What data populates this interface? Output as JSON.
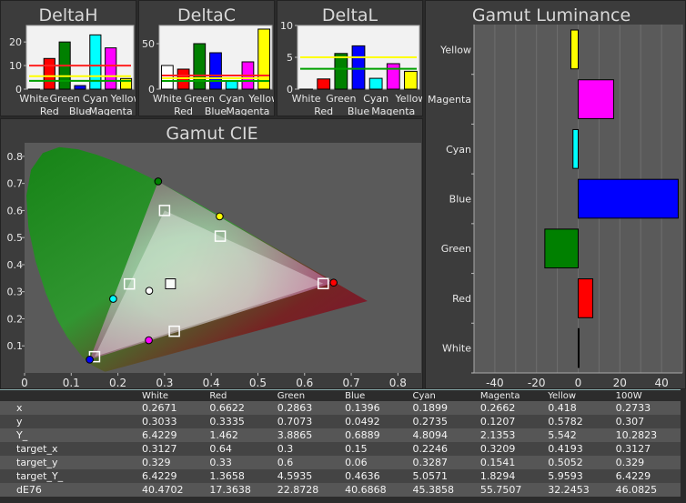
{
  "colors": {
    "White": "#ffffff",
    "Red": "#ff0000",
    "Green": "#008000",
    "Blue": "#0000ff",
    "Cyan": "#00ffff",
    "Magenta": "#ff00ff",
    "Yellow": "#ffff00"
  },
  "chart_data": [
    {
      "id": "deltaH",
      "type": "bar",
      "title": "DeltaH",
      "categories": [
        "White",
        "Red",
        "Green",
        "Blue",
        "Cyan",
        "Magenta",
        "Yellow"
      ],
      "tick_rows": [
        [
          "White",
          "Green",
          "Cyan",
          "Yellow"
        ],
        [
          "Red",
          "Blue",
          "Magenta"
        ]
      ],
      "values": [
        0,
        13,
        20,
        1.5,
        23,
        17.5,
        4.5
      ],
      "ylim": [
        0,
        27
      ],
      "yticks": [
        0,
        10,
        20
      ],
      "threshold_lines": [
        {
          "value": 10,
          "color": "#ff2020"
        },
        {
          "value": 5.5,
          "color": "#ffff00"
        },
        {
          "value": 3.5,
          "color": "#00a000"
        }
      ]
    },
    {
      "id": "deltaC",
      "type": "bar",
      "title": "DeltaC",
      "categories": [
        "White",
        "Red",
        "Green",
        "Blue",
        "Cyan",
        "Magenta",
        "Yellow"
      ],
      "tick_rows": [
        [
          "White",
          "Green",
          "Cyan",
          "Yellow"
        ],
        [
          "Red",
          "Blue",
          "Magenta"
        ]
      ],
      "values": [
        26,
        22,
        50,
        40,
        9,
        30,
        66
      ],
      "ylim": [
        0,
        70
      ],
      "yticks": [
        0,
        50
      ],
      "threshold_lines": [
        {
          "value": 15,
          "color": "#ff2020"
        },
        {
          "value": 12,
          "color": "#ffff00"
        },
        {
          "value": 9,
          "color": "#00a000"
        }
      ]
    },
    {
      "id": "deltaL",
      "type": "bar",
      "title": "DeltaL",
      "categories": [
        "White",
        "Red",
        "Green",
        "Blue",
        "Cyan",
        "Magenta",
        "Yellow"
      ],
      "tick_rows": [
        [
          "White",
          "Green",
          "Cyan",
          "Yellow"
        ],
        [
          "Red",
          "Blue",
          "Magenta"
        ]
      ],
      "values": [
        0,
        1.6,
        5.6,
        6.8,
        1.7,
        4.0,
        2.8
      ],
      "ylim": [
        0,
        10
      ],
      "yticks": [
        0,
        5,
        10
      ],
      "threshold_lines": [
        {
          "value": 5.0,
          "color": "#ffff00"
        },
        {
          "value": 3.2,
          "color": "#00a000"
        }
      ]
    },
    {
      "id": "gamutLum",
      "type": "bar",
      "orientation": "horizontal",
      "title": "Gamut Luminance",
      "categories": [
        "Yellow",
        "Magenta",
        "Cyan",
        "Blue",
        "Green",
        "Red",
        "White"
      ],
      "values": [
        -3.5,
        17,
        -2.5,
        48,
        -16,
        7,
        0
      ],
      "xlim": [
        -50,
        50
      ],
      "xticks": [
        -40,
        -20,
        0,
        20,
        40
      ]
    },
    {
      "id": "gamutCIE",
      "type": "scatter",
      "title": "Gamut CIE",
      "xlim": [
        0,
        0.85
      ],
      "ylim": [
        0,
        0.85
      ],
      "xticks": [
        "0",
        "0.1",
        "0.2",
        "0.3",
        "0.4",
        "0.5",
        "0.6",
        "0.7",
        "0.8"
      ],
      "yticks": [
        "0.1",
        "0.2",
        "0.3",
        "0.4",
        "0.5",
        "0.6",
        "0.7",
        "0.8"
      ],
      "target_triangle": [
        [
          0.64,
          0.33
        ],
        [
          0.3,
          0.6
        ],
        [
          0.15,
          0.06
        ]
      ],
      "measured_triangle": [
        [
          0.6622,
          0.3335
        ],
        [
          0.2863,
          0.7073
        ],
        [
          0.1396,
          0.0492
        ]
      ],
      "targets": [
        {
          "name": "White",
          "x": 0.3127,
          "y": 0.329
        },
        {
          "name": "Red",
          "x": 0.64,
          "y": 0.33
        },
        {
          "name": "Green",
          "x": 0.3,
          "y": 0.6
        },
        {
          "name": "Blue",
          "x": 0.15,
          "y": 0.06
        },
        {
          "name": "Cyan",
          "x": 0.2246,
          "y": 0.3287
        },
        {
          "name": "Magenta",
          "x": 0.3209,
          "y": 0.1541
        },
        {
          "name": "Yellow",
          "x": 0.4193,
          "y": 0.5052
        }
      ],
      "measured": [
        {
          "name": "White",
          "x": 0.2671,
          "y": 0.3033
        },
        {
          "name": "Red",
          "x": 0.6622,
          "y": 0.3335
        },
        {
          "name": "Green",
          "x": 0.2863,
          "y": 0.7073
        },
        {
          "name": "Blue",
          "x": 0.1396,
          "y": 0.0492
        },
        {
          "name": "Cyan",
          "x": 0.1899,
          "y": 0.2735
        },
        {
          "name": "Magenta",
          "x": 0.2662,
          "y": 0.1207
        },
        {
          "name": "Yellow",
          "x": 0.418,
          "y": 0.5782
        }
      ]
    }
  ],
  "table": {
    "columns": [
      "White",
      "Red",
      "Green",
      "Blue",
      "Cyan",
      "Magenta",
      "Yellow",
      "100W"
    ],
    "rows": [
      {
        "label": "x",
        "values": [
          "0.2671",
          "0.6622",
          "0.2863",
          "0.1396",
          "0.1899",
          "0.2662",
          "0.418",
          "0.2733"
        ]
      },
      {
        "label": "y",
        "values": [
          "0.3033",
          "0.3335",
          "0.7073",
          "0.0492",
          "0.2735",
          "0.1207",
          "0.5782",
          "0.307"
        ]
      },
      {
        "label": "Y_",
        "values": [
          "6.4229",
          "1.462",
          "3.8865",
          "0.6889",
          "4.8094",
          "2.1353",
          "5.542",
          "10.2823"
        ]
      },
      {
        "label": "target_x",
        "values": [
          "0.3127",
          "0.64",
          "0.3",
          "0.15",
          "0.2246",
          "0.3209",
          "0.4193",
          "0.3127"
        ]
      },
      {
        "label": "target_y",
        "values": [
          "0.329",
          "0.33",
          "0.6",
          "0.06",
          "0.3287",
          "0.1541",
          "0.5052",
          "0.329"
        ]
      },
      {
        "label": "target_Y_",
        "values": [
          "6.4229",
          "1.3658",
          "4.5935",
          "0.4636",
          "5.0571",
          "1.8294",
          "5.9593",
          "6.4229"
        ]
      },
      {
        "label": "dE76",
        "values": [
          "40.4702",
          "17.3638",
          "22.8728",
          "40.6868",
          "45.3858",
          "55.7507",
          "32.2453",
          "46.0825"
        ]
      }
    ]
  }
}
